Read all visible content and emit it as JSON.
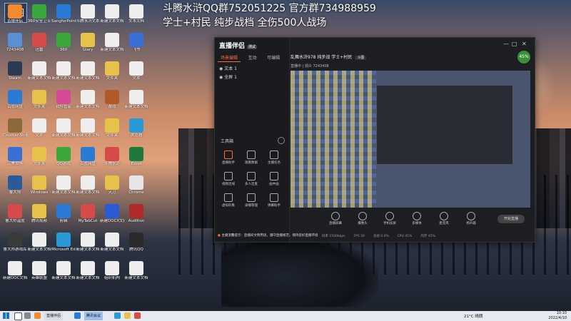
{
  "banner": {
    "line1": "斗腾水浒QQ群752051225  官方群734988959",
    "line2": "学士+村民 纯步战档 全伤500人战场"
  },
  "badge": "斗图",
  "desktop_icons": [
    {
      "label": "直播伴侣",
      "color": "#f28a2e"
    },
    {
      "label": "360安全卫士",
      "color": "#3aa83a"
    },
    {
      "label": "SangforPointer",
      "color": "#2a7bd6"
    },
    {
      "label": "斗腾水浒文本",
      "color": "#eeeeee"
    },
    {
      "label": "新建文本文档",
      "color": "#eeeeee"
    },
    {
      "label": "文本文档",
      "color": "#eeeeee"
    },
    {
      "label": "7243408",
      "color": "#5a8fd6"
    },
    {
      "label": "迅雷",
      "color": "#d64a4a"
    },
    {
      "label": "360",
      "color": "#3aa83a"
    },
    {
      "label": "Glary",
      "color": "#e6c24a"
    },
    {
      "label": "新建文本文档",
      "color": "#eeeeee"
    },
    {
      "label": "飞书",
      "color": "#3a6fd6"
    },
    {
      "label": "Steam",
      "color": "#2a3a55"
    },
    {
      "label": "新建文本文档",
      "color": "#eeeeee"
    },
    {
      "label": "新建文本文档",
      "color": "#eeeeee"
    },
    {
      "label": "新建文本文档",
      "color": "#eeeeee"
    },
    {
      "label": "文件夹",
      "color": "#e6c24a"
    },
    {
      "label": "文本",
      "color": "#eeeeee"
    },
    {
      "label": "百度网盘",
      "color": "#2a7bd6"
    },
    {
      "label": "文件夹",
      "color": "#e6c24a"
    },
    {
      "label": "软件管家",
      "color": "#d64a9a"
    },
    {
      "label": "新建文本文档",
      "color": "#eeeeee"
    },
    {
      "label": "游戏",
      "color": "#b05a2a"
    },
    {
      "label": "新建文本文档",
      "color": "#eeeeee"
    },
    {
      "label": "Counter-Strike",
      "color": "#8a6a3a"
    },
    {
      "label": "文本",
      "color": "#eeeeee"
    },
    {
      "label": "新建文本文档",
      "color": "#eeeeee"
    },
    {
      "label": "新建文本文档",
      "color": "#eeeeee"
    },
    {
      "label": "文件夹",
      "color": "#e6c24a"
    },
    {
      "label": "浏览器",
      "color": "#2a9ad6"
    },
    {
      "label": "完美世界",
      "color": "#3a6fd6"
    },
    {
      "label": "文件夹",
      "color": "#e6c24a"
    },
    {
      "label": "QQ游戏",
      "color": "#3aa83a"
    },
    {
      "label": "百度网盘",
      "color": "#2a7bd6"
    },
    {
      "label": "斗腾水浒",
      "color": "#d64a4a"
    },
    {
      "label": "Excel",
      "color": "#1e7a3a"
    },
    {
      "label": "鲁大师",
      "color": "#2a5a9a"
    },
    {
      "label": "Windows",
      "color": "#e6c24a"
    },
    {
      "label": "新建文本文档",
      "color": "#eeeeee"
    },
    {
      "label": "新建文本文档",
      "color": "#eeeeee"
    },
    {
      "label": "天刀",
      "color": "#e6c24a"
    },
    {
      "label": "Chrome",
      "color": "#e6e6e6"
    },
    {
      "label": "鲁大师温度",
      "color": "#d64a4a"
    },
    {
      "label": "腾讯视频",
      "color": "#e6c24a"
    },
    {
      "label": "剪辑",
      "color": "#2a7bd6"
    },
    {
      "label": "MyTabCut",
      "color": "#d64a4a"
    },
    {
      "label": "新建DOCX文档",
      "color": "#2a5ad6"
    },
    {
      "label": "Audition",
      "color": "#b02a2a"
    },
    {
      "label": "鲁大师游戏库",
      "color": "#3a3a3a"
    },
    {
      "label": "新建文本文档",
      "color": "#eeeeee"
    },
    {
      "label": "Microsoft Edge",
      "color": "#2a9ad6"
    },
    {
      "label": "新建文本文档",
      "color": "#eeeeee"
    },
    {
      "label": "新建文本文档",
      "color": "#eeeeee"
    },
    {
      "label": "腾讯QQ",
      "color": "#2a2a2a"
    },
    {
      "label": "新建DOC文档",
      "color": "#eeeeee"
    },
    {
      "label": "英雄联盟",
      "color": "#eeeeee"
    },
    {
      "label": "新建文本文档",
      "color": "#eeeeee"
    },
    {
      "label": "新建文本文档",
      "color": "#eeeeee"
    },
    {
      "label": "组织机构",
      "color": "#eeeeee"
    },
    {
      "label": "新建文本文档",
      "color": "#eeeeee"
    }
  ],
  "app": {
    "logo": "直播伴侣",
    "beta": "测试",
    "tabs": [
      "场景编辑",
      "互动",
      "可编辑"
    ],
    "scenes": [
      "文本 1",
      "全屏 1"
    ],
    "tools_title": "工具箱",
    "tools": [
      {
        "label": "直播助手"
      },
      {
        "label": "观看数据"
      },
      {
        "label": "主播任务"
      },
      {
        "label": "视频连线"
      },
      {
        "label": "多人连麦"
      },
      {
        "label": "画中画"
      },
      {
        "label": "虚拟形象"
      },
      {
        "label": "录播管理"
      },
      {
        "label": "弹幕助手"
      }
    ],
    "head_title": "乱舞水浒978 纯步战 学士+村民",
    "head_badge": "斗图",
    "subhead": "直播中  |  观众 7243408",
    "live_percent": "45%",
    "actions": [
      "直播屏幕",
      "摄像头",
      "手机投屏",
      "多媒体",
      "麦克风",
      "扬声器"
    ],
    "start_label": "开始直播",
    "footnote": "主播温馨提示：直播间文明用语，遵守直播规范，保持良好直播环境",
    "stats": [
      "码率 1500kbps",
      "FPS 30",
      "丢帧 0.0%",
      "CPU 41%",
      "内存 45%"
    ]
  },
  "taskbar": {
    "tasks": [
      "直播伴侣",
      "腾讯会议"
    ],
    "weather": "21°C 晴朗",
    "time": "10:10",
    "date": "2022/4/10"
  }
}
